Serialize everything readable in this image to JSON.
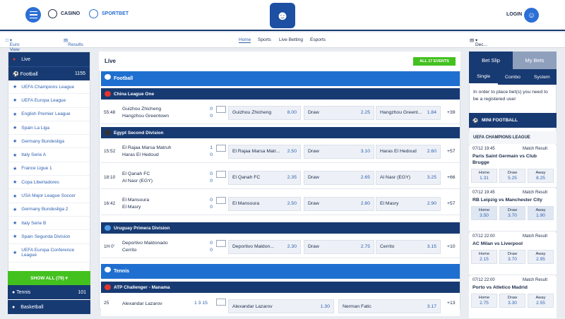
{
  "header": {
    "casino": "CASINO",
    "sportbet": "SPORTBET",
    "login": "LOGIN"
  },
  "subnav": {
    "view": "Euro View",
    "results": "Results",
    "links": [
      "Home",
      "Sports",
      "Live Betting",
      "Esports"
    ],
    "odds_format": "Dec..."
  },
  "left": {
    "live": "Live",
    "football": "Football",
    "football_count": "1155",
    "leagues": [
      "UEFA Champions League",
      "UEFA Europa League",
      "English Premier League",
      "Spain La Liga",
      "Germany Bundesliga",
      "Italy Serie A",
      "France Ligue 1",
      "Copa Libertadores",
      "USA Major League Soccer",
      "Germany Bundesliga 2",
      "Italy Serie B",
      "Spain Segunda Division",
      "UEFA Europa Conference League"
    ],
    "show_all": "SHOW ALL (79)",
    "tennis": "Tennis",
    "tennis_count": "101",
    "next": "Basketball"
  },
  "main": {
    "live": "Live",
    "all_events": "ALL 17 EVENTS",
    "football": "Football",
    "tennis": "Tennis",
    "groups": [
      {
        "league": "China League One",
        "rows": [
          {
            "time": "55:48",
            "home": "Guizhou Zhicheng",
            "away": "Hangzhou Greentown",
            "s1": "0",
            "s2": "0",
            "o1": "Guizhou Zhicheng",
            "v1": "8.00",
            "ox": "Draw",
            "vx": "2.25",
            "o2": "Hangzhou Greent...",
            "v2": "1.84",
            "more": "+39"
          }
        ]
      },
      {
        "league": "Egypt Second Division",
        "rows": [
          {
            "time": "15:52",
            "home": "El Rajaa Marsa Matruh",
            "away": "Haras El Hedoud",
            "s1": "1",
            "s2": "0",
            "o1": "El Rajaa Marsa Matr...",
            "v1": "2.50",
            "ox": "Draw",
            "vx": "3.10",
            "o2": "Haras El Hedoud",
            "v2": "2.60",
            "more": "+57"
          },
          {
            "time": "18:10",
            "home": "El Qanah FC",
            "away": "Al Nasr (EGY)",
            "s1": "0",
            "s2": "0",
            "o1": "El Qanah FC",
            "v1": "2.35",
            "ox": "Draw",
            "vx": "2.65",
            "o2": "Al Nasr (EGY)",
            "v2": "3.25",
            "more": "+66"
          },
          {
            "time": "16:42",
            "home": "El Mansoura",
            "away": "El Masry",
            "s1": "0",
            "s2": "0",
            "o1": "El Mansoura",
            "v1": "2.50",
            "ox": "Draw",
            "vx": "2.80",
            "o2": "El Masry",
            "v2": "2.90",
            "more": "+57"
          }
        ]
      },
      {
        "league": "Uruguay Primera Division",
        "rows": [
          {
            "time": "1H 0'",
            "home": "Deportivo Maldonado",
            "away": "Cerrito",
            "s1": "0",
            "s2": "0",
            "o1": "Deportivo Maldon...",
            "v1": "2.30",
            "ox": "Draw",
            "vx": "2.75",
            "o2": "Cerrito",
            "v2": "3.15",
            "more": "+10"
          }
        ]
      }
    ],
    "tennis_league": "ATP Challenger - Manama",
    "tennis_row": {
      "time": "25",
      "home": "Alexandar Lazarov",
      "score": "1 3 15",
      "o1": "Alexandar Lazarov",
      "v1": "1.30",
      "o2": "Nerman Fatic",
      "v2": "3.17",
      "more": "+13"
    }
  },
  "right": {
    "betslip": "Bet Slip",
    "mybets": "My Bets",
    "single": "Single",
    "combo": "Combo",
    "system": "System",
    "notice": "In order to place bet(s) you need to be a registered user",
    "mini": "MINI FOOTBALL",
    "mini_league": "UEFA CHAMPIONS LEAGUE",
    "result": "Match Result",
    "matches": [
      {
        "date": "07/12 19:45",
        "teams": "Paris Saint Germain vs Club Brugge",
        "h": "1.31",
        "d": "5.25",
        "a": "8.25"
      },
      {
        "date": "07/12 19:45",
        "teams": "RB Leipzig vs Manchester City",
        "h": "3.50",
        "d": "3.70",
        "a": "1.90"
      },
      {
        "date": "07/12 22:00",
        "teams": "AC Milan vs Liverpool",
        "h": "2.15",
        "d": "3.70",
        "a": "2.95"
      },
      {
        "date": "07/12 22:00",
        "teams": "Porto vs Atletico Madrid",
        "h": "2.75",
        "d": "3.30",
        "a": "2.55"
      }
    ],
    "home": "Home",
    "draw": "Draw",
    "away": "Away"
  },
  "colors": {
    "navy": "#173a72",
    "blue": "#1f6fd0",
    "green": "#43c11f"
  }
}
